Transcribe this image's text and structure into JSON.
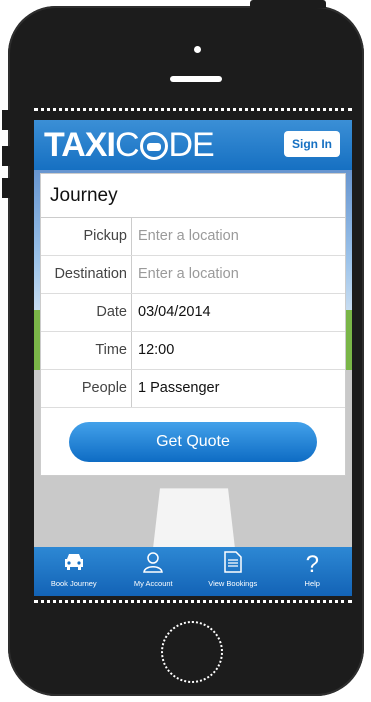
{
  "header": {
    "logo_taxi": "TAXI",
    "logo_code": "DE",
    "sign_in": "Sign In"
  },
  "form": {
    "title": "Journey",
    "rows": [
      {
        "label": "Pickup",
        "value": "",
        "placeholder": "Enter a location"
      },
      {
        "label": "Destination",
        "value": "",
        "placeholder": "Enter a location"
      },
      {
        "label": "Date",
        "value": "03/04/2014"
      },
      {
        "label": "Time",
        "value": "12:00"
      },
      {
        "label": "People",
        "value": "1 Passenger"
      }
    ],
    "quote_button": "Get Quote"
  },
  "tabs": [
    {
      "label": "Book Journey",
      "icon": "car-icon"
    },
    {
      "label": "My Account",
      "icon": "person-icon"
    },
    {
      "label": "View Bookings",
      "icon": "document-icon"
    },
    {
      "label": "Help",
      "icon": "question-icon"
    }
  ],
  "colors": {
    "brand_blue": "#1670c2",
    "button_blue": "#2a8ee0",
    "phone": "#1c1c1c"
  }
}
